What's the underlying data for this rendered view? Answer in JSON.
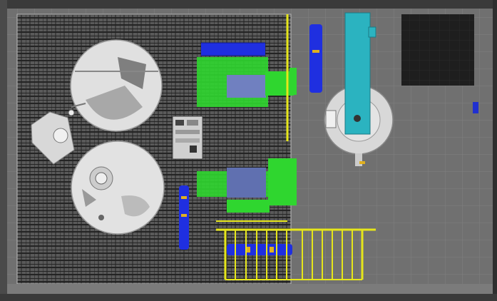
{
  "viewer": {
    "scene": "plant-layout-top-view",
    "colors": {
      "floor": "#6f6f6f",
      "grating": "#1a1a1a",
      "equipment": "#d9d9d9",
      "pump_green": "#2fdc2f",
      "motor_blue": "#1f2fe0",
      "railing_yellow": "#e6e61a",
      "vessel_teal": "#2bb3c0",
      "dark_panel": "#1c1c1c"
    }
  }
}
